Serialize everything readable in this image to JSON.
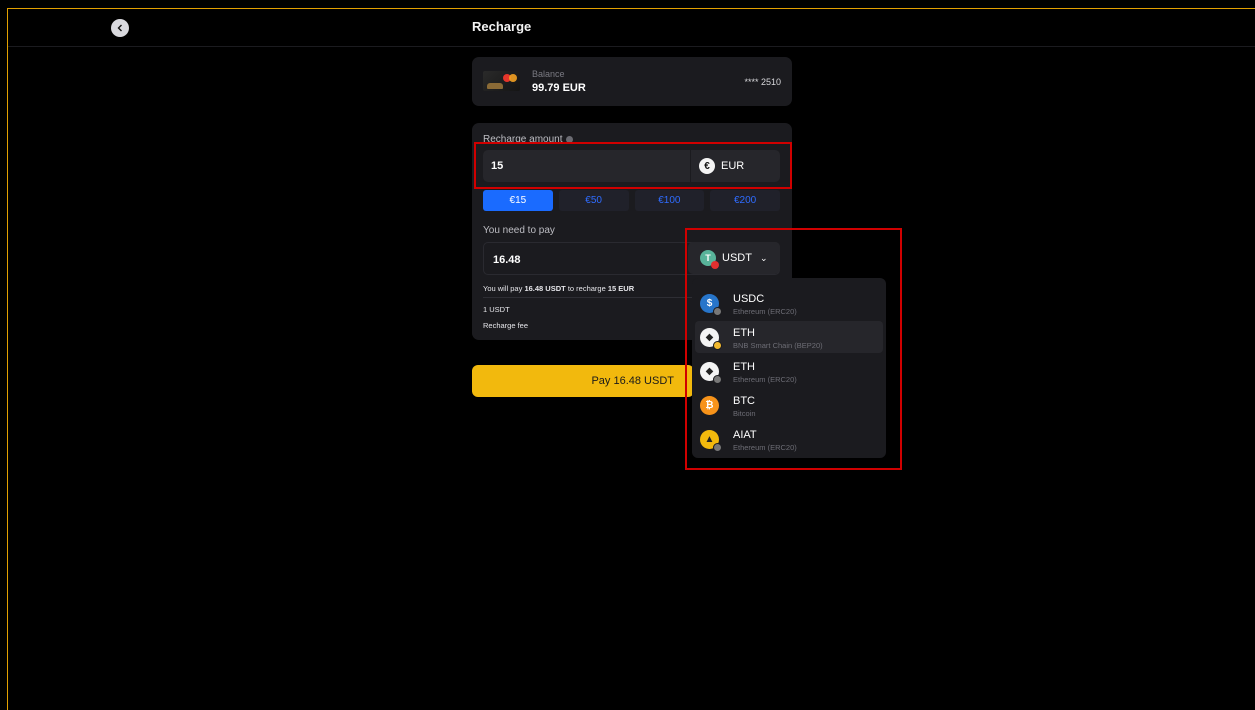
{
  "header": {
    "title": "Recharge"
  },
  "card": {
    "balance_label": "Balance",
    "balance_value": "99.79 EUR",
    "card_number": "**** 2510"
  },
  "recharge": {
    "amount_label": "Recharge amount",
    "amount_value": "15",
    "currency": "EUR",
    "presets": [
      "€15",
      "€50",
      "€100",
      "€200"
    ],
    "selected_preset": "€15"
  },
  "payment": {
    "need_to_pay_label": "You need to pay",
    "pay_value": "16.48",
    "pay_currency": "USDT",
    "note_prefix": "You will pay",
    "note_amount": "16.48 USDT",
    "note_middle": "to recharge",
    "note_target": "15 EUR",
    "rate_label": "1 USDT",
    "fee_label": "Recharge fee"
  },
  "pay_button": {
    "label": "Pay 16.48 USDT"
  },
  "dropdown": {
    "items": [
      {
        "symbol": "USDC",
        "network": "Ethereum (ERC20)",
        "icon": "usdc-icon",
        "color": "#2775ca"
      },
      {
        "symbol": "ETH",
        "network": "BNB Smart Chain (BEP20)",
        "icon": "eth-icon",
        "color": "#f4f4f4"
      },
      {
        "symbol": "ETH",
        "network": "Ethereum (ERC20)",
        "icon": "eth-icon",
        "color": "#f4f4f4"
      },
      {
        "symbol": "BTC",
        "network": "Bitcoin",
        "icon": "btc-icon",
        "color": "#f7931a"
      },
      {
        "symbol": "AIAT",
        "network": "Ethereum (ERC20)",
        "icon": "aiat-icon",
        "color": "#f2b90d"
      }
    ]
  },
  "colors": {
    "accent": "#f2b90d",
    "primary_blue": "#1a6bff",
    "highlight": "#d00000"
  }
}
